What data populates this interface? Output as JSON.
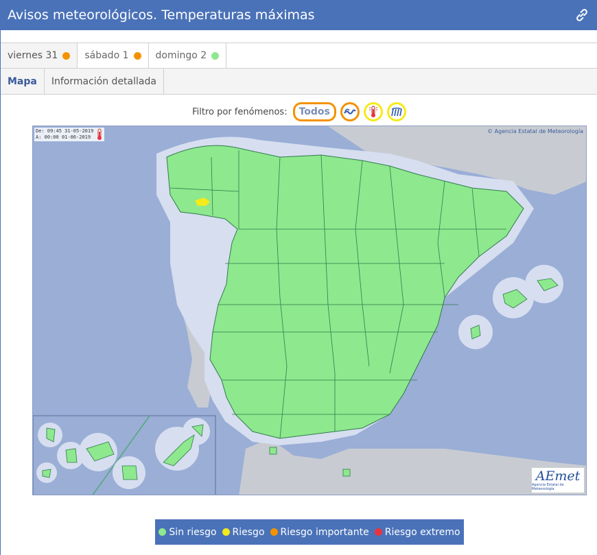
{
  "header": {
    "title": "Avisos meteorológicos. Temperaturas máximas"
  },
  "day_tabs": [
    {
      "label": "viernes 31",
      "status_color": "#f39200"
    },
    {
      "label": "sábado 1",
      "status_color": "#f39200"
    },
    {
      "label": "domingo 2",
      "status_color": "#8ee88e"
    }
  ],
  "view_tabs": [
    {
      "label": "Mapa"
    },
    {
      "label": "Información detallada"
    }
  ],
  "filter": {
    "label": "Filtro por fenómenos:",
    "todos": "Todos",
    "icons": [
      "coastal-waves-icon",
      "thermometer-icon",
      "rain-icon"
    ]
  },
  "map": {
    "timestamp_de_label": "De:",
    "timestamp_de": "09:45 31-05-2019",
    "timestamp_a_label": "A:",
    "timestamp_a": "00:00 01-06-2019",
    "copyright": "© Agencia Estatal de Meteorología",
    "logo_text": "AEmet",
    "logo_sub": "Agencia Estatal de Meteorología"
  },
  "legend": [
    {
      "label": "Sin riesgo",
      "color": "#8ee88e"
    },
    {
      "label": "Riesgo",
      "color": "#f5ea1a"
    },
    {
      "label": "Riesgo importante",
      "color": "#f39200"
    },
    {
      "label": "Riesgo extremo",
      "color": "#e8333f"
    }
  ],
  "colors": {
    "brand": "#4a72b8",
    "sea": "#9aaed6",
    "land_foreign": "#c8ccd2",
    "no_risk": "#8ee88e",
    "risk": "#f5ea1a"
  }
}
